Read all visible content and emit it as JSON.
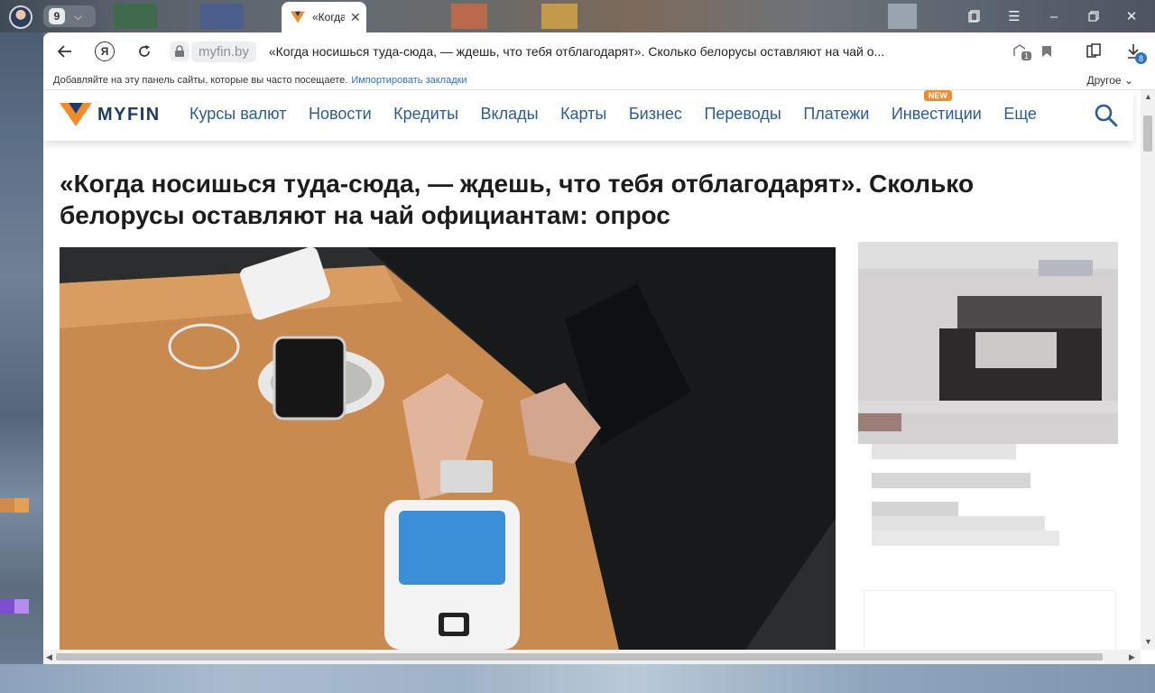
{
  "tabstrip": {
    "tab_count": "9",
    "active_tab_title": "«Когда носишься туда-сюда",
    "colors": {
      "accent_orange": "#f28c2a",
      "brand_blue": "#1d3a6b"
    }
  },
  "toolbar": {
    "domain": "myfin.by",
    "page_title": "«Когда носишься туда-сюда, — ждешь, что тебя отблагодарят». Сколько белорусы оставляют на чай о...",
    "yandex_letter": "Я",
    "extension_badge": "1",
    "download_badge": "8"
  },
  "bookmarks": {
    "hint": "Добавляйте на эту панель сайты, которые вы часто посещаете.",
    "import_link": "Импортировать закладки",
    "other": "Другое"
  },
  "site": {
    "brand": "MYFIN",
    "nav": [
      {
        "label": "Курсы валют"
      },
      {
        "label": "Новости"
      },
      {
        "label": "Кредиты"
      },
      {
        "label": "Вклады"
      },
      {
        "label": "Карты"
      },
      {
        "label": "Бизнес"
      },
      {
        "label": "Переводы"
      },
      {
        "label": "Платежи"
      },
      {
        "label": "Инвестиции",
        "badge": "NEW"
      },
      {
        "label": "Еще"
      }
    ]
  },
  "article": {
    "headline": "«Когда носишься туда-сюда, — ждешь, что тебя отблагодарят». Сколько белорусы оставляют на чай официантам: опрос"
  }
}
